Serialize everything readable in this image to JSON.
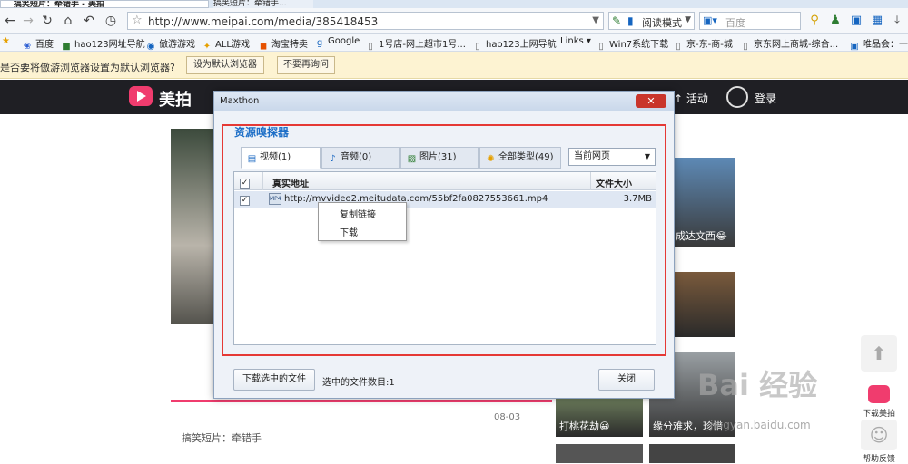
{
  "browser": {
    "tab_title": "搞笑短片：牵错手 - 美拍",
    "tab2_title": "搞笑短片：牵错手...",
    "url": "http://www.meipai.com/media/385418453",
    "read_mode": "阅读模式",
    "search_placeholder": "百度",
    "search_engine": "百度"
  },
  "bookmarks": [
    {
      "label": "百度"
    },
    {
      "label": "hao123网址导航"
    },
    {
      "label": "傲游游戏"
    },
    {
      "label": "ALL游戏"
    },
    {
      "label": "淘宝特卖"
    },
    {
      "label": "Google"
    },
    {
      "label": "1号店-网上超市1号..."
    },
    {
      "label": "hao123上网导航"
    },
    {
      "label": "Links"
    },
    {
      "label": "Win7系统下载"
    },
    {
      "label": "京-东-商-城"
    },
    {
      "label": "京东网上商城-综合..."
    },
    {
      "label": "唯品会：一..."
    }
  ],
  "notify": {
    "message": "是否要将傲游浏览器设置为默认浏览器?",
    "set_default": "设为默认浏览器",
    "dont_ask": "不要再询问"
  },
  "site": {
    "name": "美拍",
    "activity": "活动",
    "login": "登录",
    "date": "08-03",
    "video_title": "搞笑短片：牵错手",
    "thumbs": [
      {
        "caption": "成达文西😂"
      },
      {
        "caption": ""
      },
      {
        "caption": "打桃花劫😀"
      },
      {
        "caption": "缘分难求，珍惜"
      }
    ],
    "side_download": "下载美拍",
    "side_feedback": "帮助反馈"
  },
  "dialog": {
    "window_title": "Maxthon",
    "close_glyph": "✕",
    "heading": "资源嗅探器",
    "tabs": [
      {
        "label": "视频(1)"
      },
      {
        "label": "音频(0)"
      },
      {
        "label": "图片(31)"
      },
      {
        "label": "全部类型(49)"
      }
    ],
    "scope": "当前网页",
    "columns": {
      "url": "真实地址",
      "size": "文件大小"
    },
    "rows": [
      {
        "url": "http://mvvideo2.meitudata.com/55bf2fa0827553661.mp4",
        "size": "3.7MB",
        "type": "MP4"
      }
    ],
    "context_menu": [
      "复制链接",
      "下载"
    ],
    "download_button": "下载选中的文件",
    "selected_count": "选中的文件数目:1",
    "close_button": "关闭"
  },
  "watermark": {
    "brand": "Bai 经验",
    "domain": "jingyan.baidu.com"
  },
  "colors": {
    "accent": "#f03c6e",
    "dialog_border": "#e53935",
    "heading": "#1e6fc7"
  }
}
